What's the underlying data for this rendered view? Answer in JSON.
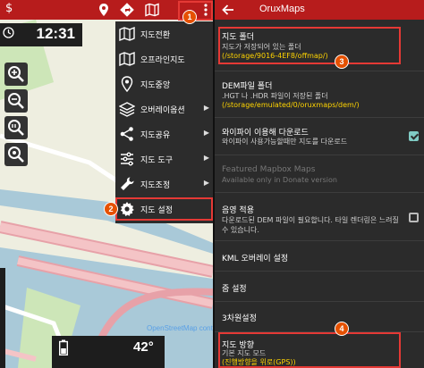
{
  "left": {
    "logo": "$",
    "clock": "12:31",
    "temperature": "42",
    "temperature_unit": "°",
    "map_attribution": "OpenStreetMap contributors",
    "menu": [
      {
        "label": "지도전환",
        "icon": "map-icon",
        "submenu": false
      },
      {
        "label": "오프라인지도",
        "icon": "offline-map-icon",
        "submenu": false
      },
      {
        "label": "지도중앙",
        "icon": "center-pin-icon",
        "submenu": false
      },
      {
        "label": "오버레이옵션",
        "icon": "layers-icon",
        "submenu": true
      },
      {
        "label": "지도공유",
        "icon": "share-icon",
        "submenu": true
      },
      {
        "label": "지도 도구",
        "icon": "tools-icon",
        "submenu": true
      },
      {
        "label": "지도조정",
        "icon": "wrench-icon",
        "submenu": true
      },
      {
        "label": "지도 설정",
        "icon": "gear-icon",
        "submenu": false
      }
    ]
  },
  "right": {
    "title": "OruxMaps",
    "prefs": [
      {
        "title": "지도 폴더",
        "sub": "지도가 저장되어 있는 폴더",
        "sub2": "(/storage/9016-4EF8/offmap/)",
        "sub2_yellow": true
      },
      {
        "title": "DEM파일 폴더",
        "sub": ".HGT 나 .HDR 파일이 저장된 폴더",
        "sub2": "(/storage/emulated/0/oruxmaps/dem/)",
        "sub2_yellow": true
      },
      {
        "title": "와이파이 이용해 다운로드",
        "sub": "와이파이 사용가능할때만 지도를 다운로드",
        "checkbox": true,
        "checked": true
      },
      {
        "title": "Featured Mapbox Maps",
        "sub": "Available only in Donate version",
        "disabled": true
      },
      {
        "title": "음영 적용",
        "sub": "다운로드된 DEM 파일이 필요합니다. 타일 렌더링은 느려질",
        "sub2": "수 있습니다.",
        "checkbox": true,
        "checked": false
      },
      {
        "title": "KML 오버레이 설정"
      },
      {
        "title": "줌 설정"
      },
      {
        "title": "3차원설정"
      },
      {
        "title": "지도 방향",
        "sub": "기본 지도 모드",
        "sub2": "(진행방향을 위로(GPS))",
        "sub2_yellow": true
      }
    ]
  },
  "badges": [
    "1",
    "2",
    "3",
    "4"
  ],
  "colors": {
    "accent": "#b71c1c",
    "highlight": "#e53935",
    "badge": "#e65100",
    "path_yellow": "#ffd400"
  }
}
